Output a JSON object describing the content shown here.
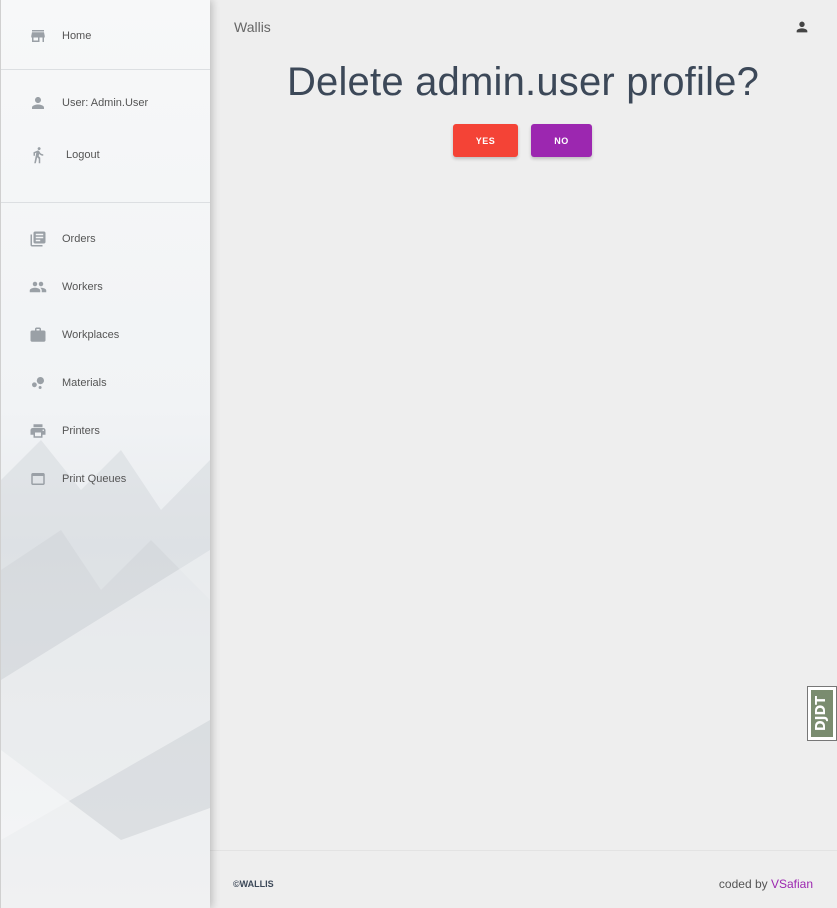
{
  "sidebar": {
    "top_items": [
      {
        "label": "Home",
        "icon": "store-icon"
      }
    ],
    "account_items": [
      {
        "label": "User: Admin.User",
        "icon": "person-icon"
      },
      {
        "label": "Logout",
        "icon": "walking-person-icon"
      }
    ],
    "items": [
      {
        "label": "Orders",
        "icon": "library-books-icon"
      },
      {
        "label": "Workers",
        "icon": "people-icon"
      },
      {
        "label": "Workplaces",
        "icon": "briefcase-icon"
      },
      {
        "label": "Materials",
        "icon": "bubbles-icon"
      },
      {
        "label": "Printers",
        "icon": "printer-icon"
      },
      {
        "label": "Print Queues",
        "icon": "window-icon"
      }
    ]
  },
  "header": {
    "title": "Wallis",
    "user_icon": "person-icon"
  },
  "main": {
    "heading": "Delete admin.user profile?",
    "yes_label": "YES",
    "no_label": "NO"
  },
  "footer": {
    "copyright": "©WALLIS",
    "coded_by_prefix": "coded by ",
    "author": "VSafian"
  },
  "debug_toolbar": {
    "label": "DJDT"
  },
  "colors": {
    "yes": "#f44336",
    "no": "#9c27b0",
    "heading": "#3c4858",
    "background": "#eeeeee"
  }
}
